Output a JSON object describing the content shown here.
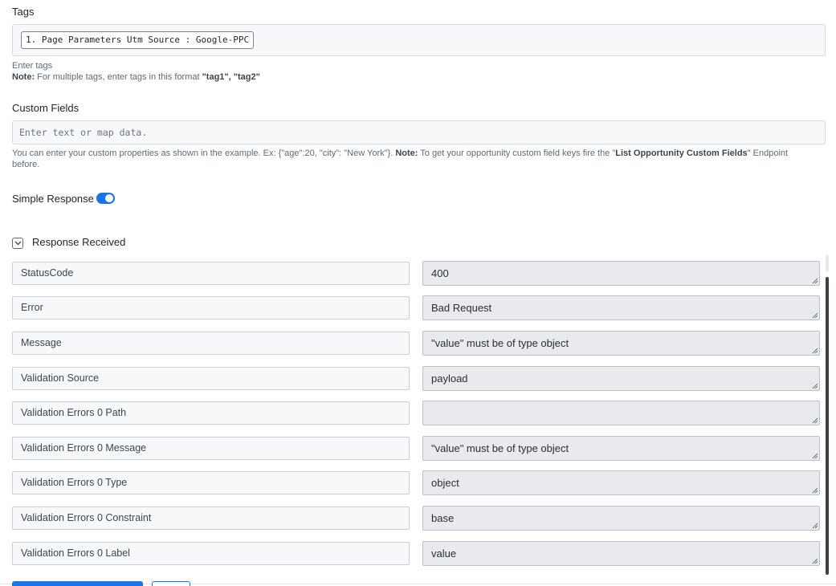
{
  "tags": {
    "label": "Tags",
    "chips": [
      "1. Page Parameters Utm Source : Google-PPC"
    ],
    "help_line": "Enter tags",
    "note_prefix": "Note:",
    "note_text": " For multiple tags, enter tags in this format ",
    "note_format": "\"tag1\", \"tag2\""
  },
  "custom_fields": {
    "label": "Custom Fields",
    "placeholder": "Enter text or map data.",
    "help_text": "You can enter your custom properties as shown in the example. Ex: {\"age\":20, \"city\": \"New York\"}. ",
    "help_note_prefix": "Note:",
    "help_note_text": " To get your opportunity custom field keys fire the \"",
    "help_endpoint": "List Opportunity Custom Fields",
    "help_tail": "\" Endpoint before."
  },
  "simple_response": {
    "label": "Simple Response",
    "enabled": true
  },
  "response": {
    "label": "Response Received",
    "rows": [
      {
        "key": "StatusCode",
        "value": "400"
      },
      {
        "key": "Error",
        "value": "Bad Request"
      },
      {
        "key": "Message",
        "value": "\"value\" must be of type object"
      },
      {
        "key": "Validation Source",
        "value": "payload"
      },
      {
        "key": "Validation Errors 0 Path",
        "value": ""
      },
      {
        "key": "Validation Errors 0 Message",
        "value": "\"value\" must be of type object"
      },
      {
        "key": "Validation Errors 0 Type",
        "value": "object"
      },
      {
        "key": "Validation Errors 0 Constraint",
        "value": "base"
      },
      {
        "key": "Validation Errors 0 Label",
        "value": "value"
      }
    ]
  },
  "colors": {
    "accent": "#1a73e8",
    "field_bg": "#f6f8fa",
    "value_bg": "#e8eaed"
  }
}
